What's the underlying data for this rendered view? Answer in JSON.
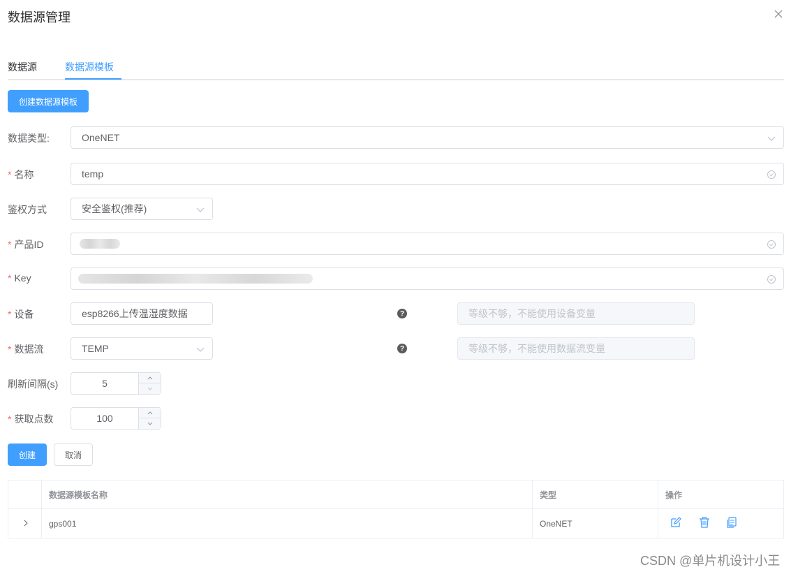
{
  "dialog": {
    "title": "数据源管理"
  },
  "tabs": [
    {
      "label": "数据源",
      "active": false
    },
    {
      "label": "数据源模板",
      "active": true
    }
  ],
  "create_template_button": "创建数据源模板",
  "form": {
    "data_type": {
      "label": "数据类型:",
      "required": false,
      "value": "OneNET"
    },
    "name": {
      "label": "名称",
      "required": true,
      "value": "temp"
    },
    "auth": {
      "label": "鉴权方式",
      "required": false,
      "value": "安全鉴权(推荐)"
    },
    "product_id": {
      "label": "产品ID",
      "required": true,
      "value": ""
    },
    "key": {
      "label": "Key",
      "required": true,
      "value": ""
    },
    "device": {
      "label": "设备",
      "required": true,
      "value": "esp8266上传温湿度数据",
      "variable_placeholder": "等级不够，不能使用设备变量"
    },
    "datastream": {
      "label": "数据流",
      "required": true,
      "value": "TEMP",
      "variable_placeholder": "等级不够，不能使用数据流变量"
    },
    "refresh": {
      "label": "刷新间隔(s)",
      "required": false,
      "value": "5"
    },
    "points": {
      "label": "获取点数",
      "required": true,
      "value": "100"
    }
  },
  "buttons": {
    "create": "创建",
    "cancel": "取消"
  },
  "table": {
    "headers": [
      "",
      "数据源模板名称",
      "类型",
      "操作"
    ],
    "rows": [
      {
        "name": "gps001",
        "type": "OneNET"
      }
    ]
  },
  "colors": {
    "primary": "#409eff",
    "required": "#f56c6c",
    "border": "#dcdfe6"
  },
  "watermark": "CSDN @单片机设计小王"
}
